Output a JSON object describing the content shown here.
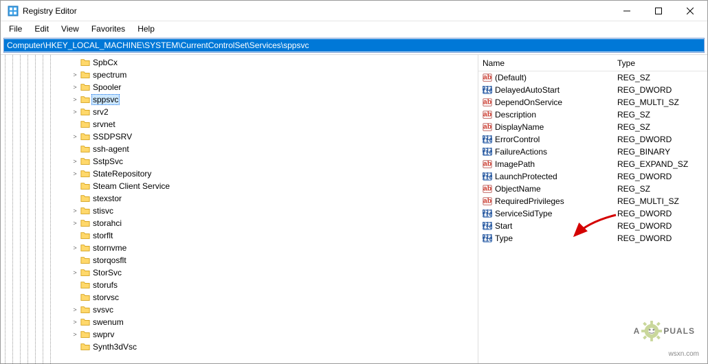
{
  "window": {
    "title": "Registry Editor"
  },
  "menu": {
    "file": "File",
    "edit": "Edit",
    "view": "View",
    "favorites": "Favorites",
    "help": "Help"
  },
  "address": {
    "path": "Computer\\HKEY_LOCAL_MACHINE\\SYSTEM\\CurrentControlSet\\Services\\sppsvc"
  },
  "tree": [
    {
      "label": "SpbCx",
      "exp": ""
    },
    {
      "label": "spectrum",
      "exp": ">"
    },
    {
      "label": "Spooler",
      "exp": ">"
    },
    {
      "label": "sppsvc",
      "exp": ">",
      "selected": true
    },
    {
      "label": "srv2",
      "exp": ">"
    },
    {
      "label": "srvnet",
      "exp": ""
    },
    {
      "label": "SSDPSRV",
      "exp": ">"
    },
    {
      "label": "ssh-agent",
      "exp": ""
    },
    {
      "label": "SstpSvc",
      "exp": ">"
    },
    {
      "label": "StateRepository",
      "exp": ">"
    },
    {
      "label": "Steam Client Service",
      "exp": ""
    },
    {
      "label": "stexstor",
      "exp": ""
    },
    {
      "label": "stisvc",
      "exp": ">"
    },
    {
      "label": "storahci",
      "exp": ">"
    },
    {
      "label": "storflt",
      "exp": ""
    },
    {
      "label": "stornvme",
      "exp": ">"
    },
    {
      "label": "storqosflt",
      "exp": ""
    },
    {
      "label": "StorSvc",
      "exp": ">"
    },
    {
      "label": "storufs",
      "exp": ""
    },
    {
      "label": "storvsc",
      "exp": ""
    },
    {
      "label": "svsvc",
      "exp": ">"
    },
    {
      "label": "swenum",
      "exp": ">"
    },
    {
      "label": "swprv",
      "exp": ">"
    },
    {
      "label": "Synth3dVsc",
      "exp": ""
    }
  ],
  "columns": {
    "name": "Name",
    "type": "Type"
  },
  "values": [
    {
      "name": "(Default)",
      "type": "REG_SZ",
      "icon": "ab"
    },
    {
      "name": "DelayedAutoStart",
      "type": "REG_DWORD",
      "icon": "bin"
    },
    {
      "name": "DependOnService",
      "type": "REG_MULTI_SZ",
      "icon": "ab"
    },
    {
      "name": "Description",
      "type": "REG_SZ",
      "icon": "ab"
    },
    {
      "name": "DisplayName",
      "type": "REG_SZ",
      "icon": "ab"
    },
    {
      "name": "ErrorControl",
      "type": "REG_DWORD",
      "icon": "bin"
    },
    {
      "name": "FailureActions",
      "type": "REG_BINARY",
      "icon": "bin"
    },
    {
      "name": "ImagePath",
      "type": "REG_EXPAND_SZ",
      "icon": "ab"
    },
    {
      "name": "LaunchProtected",
      "type": "REG_DWORD",
      "icon": "bin"
    },
    {
      "name": "ObjectName",
      "type": "REG_SZ",
      "icon": "ab"
    },
    {
      "name": "RequiredPrivileges",
      "type": "REG_MULTI_SZ",
      "icon": "ab"
    },
    {
      "name": "ServiceSidType",
      "type": "REG_DWORD",
      "icon": "bin"
    },
    {
      "name": "Start",
      "type": "REG_DWORD",
      "icon": "bin"
    },
    {
      "name": "Type",
      "type": "REG_DWORD",
      "icon": "bin"
    }
  ],
  "watermark": {
    "textA": "A",
    "textB": "PUALS"
  },
  "footer": {
    "site": "wsxn.com"
  }
}
